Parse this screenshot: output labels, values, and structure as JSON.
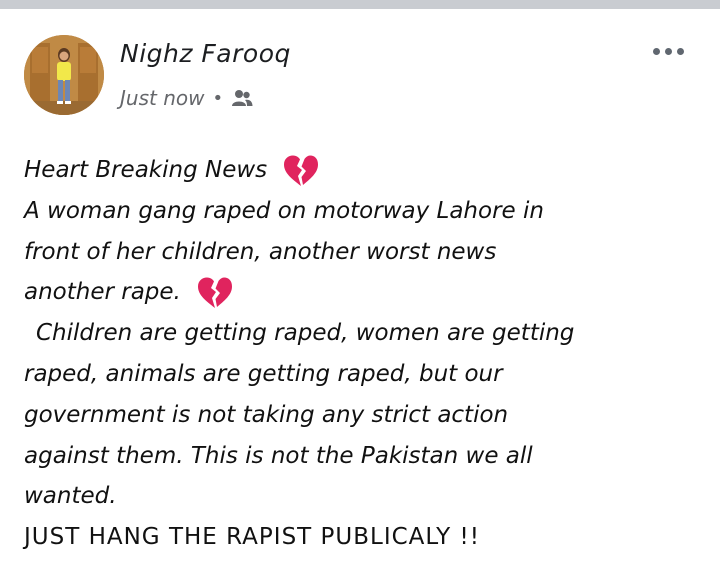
{
  "post": {
    "author": "Nighz Farooq",
    "timestamp": "Just now",
    "separator": "•",
    "audience_icon": "friends-icon",
    "menu_icon": "more-options-icon",
    "text_lines": [
      "Heart Breaking News",
      "A woman gang raped on motorway Lahore in",
      "front of her children, another worst news",
      "another rape.",
      "Children are getting raped, women are getting",
      "raped, animals are getting raped, but our",
      "government is not taking any strict action",
      "against them. This is not the Pakistan we all",
      "wanted.",
      "JUST HANG THE RAPIST PUBLICALY !!"
    ],
    "emoji": "broken-heart-icon"
  },
  "colors": {
    "topbar": "#c9ccd1",
    "meta_text": "#65676b",
    "heart": "#e0245e"
  }
}
